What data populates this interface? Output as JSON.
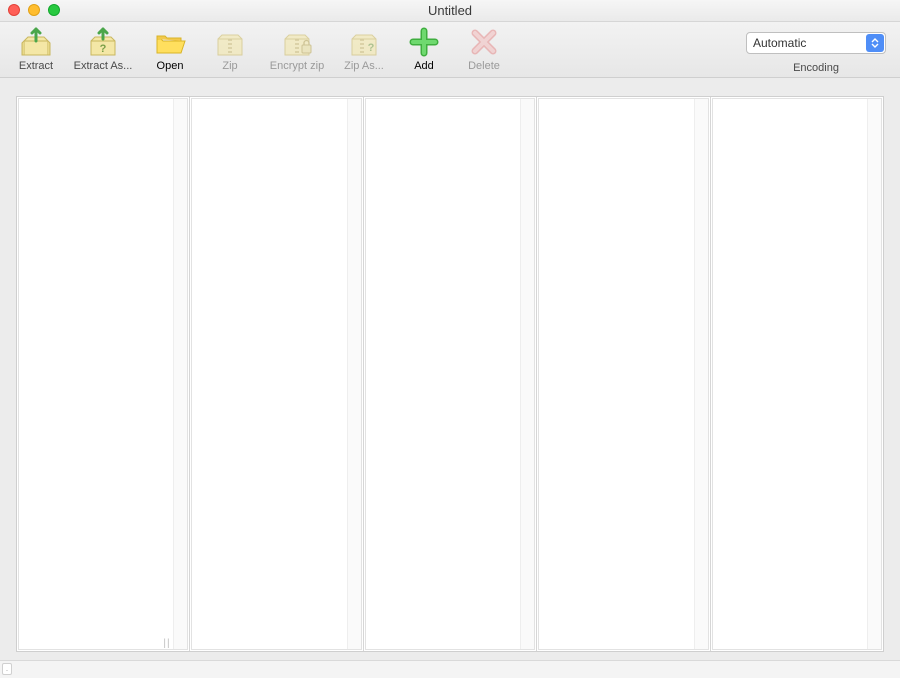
{
  "window": {
    "title": "Untitled"
  },
  "toolbar": {
    "items": [
      {
        "id": "extract",
        "label": "Extract",
        "enabled": true
      },
      {
        "id": "extract_as",
        "label": "Extract As...",
        "enabled": true
      },
      {
        "id": "open",
        "label": "Open",
        "enabled": true,
        "emphasized": true
      },
      {
        "id": "zip",
        "label": "Zip",
        "enabled": false
      },
      {
        "id": "encrypt_zip",
        "label": "Encrypt zip",
        "enabled": false
      },
      {
        "id": "zip_as",
        "label": "Zip As...",
        "enabled": false
      },
      {
        "id": "add",
        "label": "Add",
        "enabled": true,
        "emphasized": true
      },
      {
        "id": "delete",
        "label": "Delete",
        "enabled": false
      }
    ]
  },
  "encoding": {
    "label": "Encoding",
    "selected": "Automatic"
  },
  "columns": {
    "count": 5
  },
  "statusbar": {
    "text": "."
  }
}
